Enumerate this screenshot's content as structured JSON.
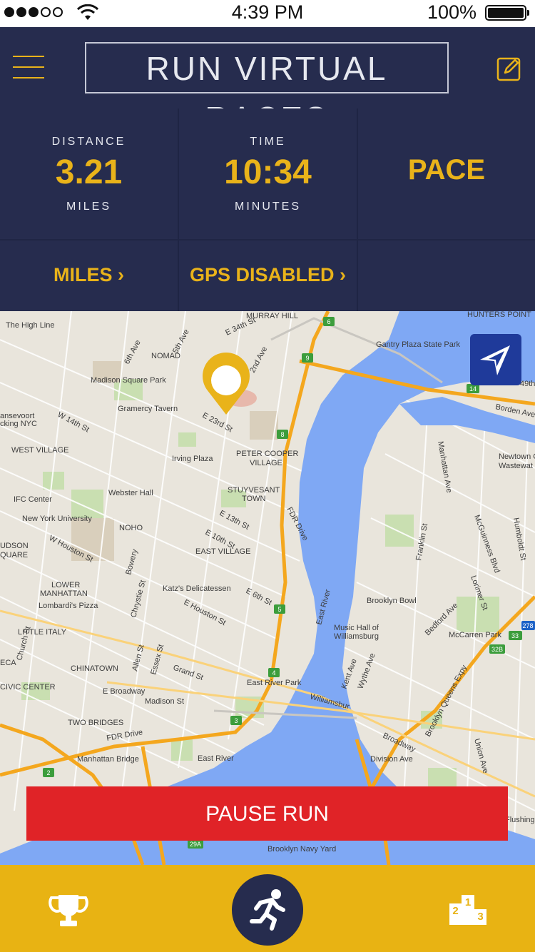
{
  "status_bar": {
    "time": "4:39 PM",
    "battery": "100%",
    "signal_bars_filled": 3,
    "signal_bars_total": 5
  },
  "header": {
    "title": "RUN VIRTUAL RACES",
    "menu_icon": "hamburger-menu-icon",
    "edit_icon": "edit-pencil-icon"
  },
  "stats": {
    "distance": {
      "label": "DISTANCE",
      "value": "3.21",
      "unit": "MILES"
    },
    "time": {
      "label": "TIME",
      "value": "10:34",
      "unit": "MINUTES"
    },
    "pace": {
      "label": "PACE"
    },
    "miles_button": "MILES ›",
    "gps_button": "GPS DISABLED ›"
  },
  "map": {
    "labels": [
      "MURRAY HILL",
      "HUNTERS POINT",
      "The High Line",
      "E 34th St",
      "Gantry Plaza State Park",
      "NOMAD",
      "6th Ave",
      "5th Ave",
      "2nd Ave",
      "Madison Square Park",
      "Gramercy Tavern",
      "E 23rd St",
      "W 14th St",
      "ansevoort",
      "cking NYC",
      "Borden Ave",
      "49th",
      "WEST VILLAGE",
      "PETER COOPER",
      "VILLAGE",
      "Irving Plaza",
      "Newtown C",
      "Wastewat",
      "STUYVESANT",
      "TOWN",
      "Webster Hall",
      "IFC Center",
      "New York University",
      "NOHO",
      "E 13th St",
      "E 10th St",
      "EAST VILLAGE",
      "W Houston St",
      "UDSON",
      "QUARE",
      "FDR Drive",
      "Manhattan Ave",
      "McGuinness Blvd",
      "Humboldt St",
      "Franklin St",
      "Bowery",
      "LOWER",
      "MANHATTAN",
      "Lombardi's Pizza",
      "Katz's Delicatessen",
      "E Houston St",
      "E 6th St",
      "East River",
      "Brooklyn Bowl",
      "Lorimer St",
      "Chrystie St",
      "LITTLE ITALY",
      "Music Hall of",
      "Williamsburg",
      "McCarren Park",
      "Bedford Ave",
      "Church St",
      "Allen St",
      "Essex St",
      "CHINATOWN",
      "Grand St",
      "Kent Ave",
      "Wythe Ave",
      "Brooklyn Queens Expy",
      "CIVIC CENTER",
      "E Broadway",
      "East River Park",
      "Williamsbur",
      "Madison St",
      "ECA",
      "TWO BRIDGES",
      "Broadway",
      "FDR Drive",
      "Manhattan Bridge",
      "East River",
      "Division Ave",
      "Union Ave",
      "Brooklyn Navy Yard",
      "Flushing"
    ],
    "route_badges": [
      "278",
      "33",
      "32B",
      "29A",
      "14",
      "9",
      "8",
      "6",
      "5",
      "4",
      "3",
      "2"
    ],
    "recenter_icon": "navigation-arrow-icon",
    "marker_icon": "location-pin-icon"
  },
  "actions": {
    "pause_run": "PAUSE RUN"
  },
  "tab_bar": {
    "left_icon": "trophy-icon",
    "center_icon": "runner-icon",
    "right_icon": "leaderboard-podium-icon",
    "podium_labels": [
      "2",
      "1",
      "3"
    ]
  },
  "colors": {
    "accent": "#e9b31a",
    "navy": "#262c4e",
    "navy_dark": "#1f2544",
    "pause_red": "#e02327",
    "water": "#7fa8f4",
    "land": "#e9e5dc"
  }
}
